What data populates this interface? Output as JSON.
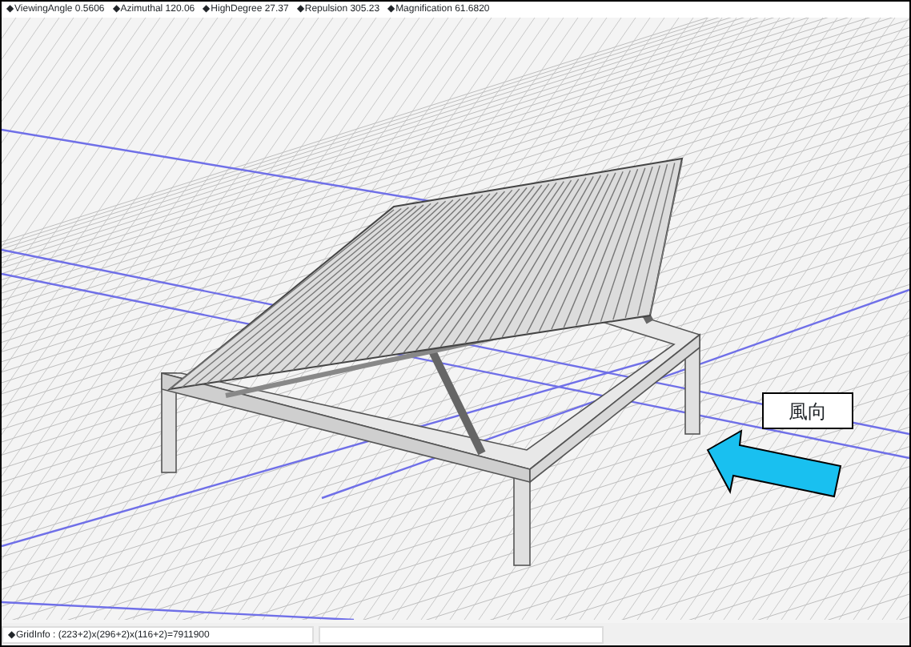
{
  "top_status": [
    {
      "label": "◆ViewingAngle",
      "value": "0.5606"
    },
    {
      "label": "◆Azimuthal",
      "value": "120.06"
    },
    {
      "label": "◆HighDegree",
      "value": "27.37"
    },
    {
      "label": "◆Repulsion",
      "value": "305.23"
    },
    {
      "label": "◆Magnification",
      "value": "61.6820"
    }
  ],
  "viewport": {
    "wind_label": "風向"
  },
  "bottom_status": {
    "grid_info": "◆GridInfo : (223+2)x(296+2)x(116+2)=7911900"
  }
}
